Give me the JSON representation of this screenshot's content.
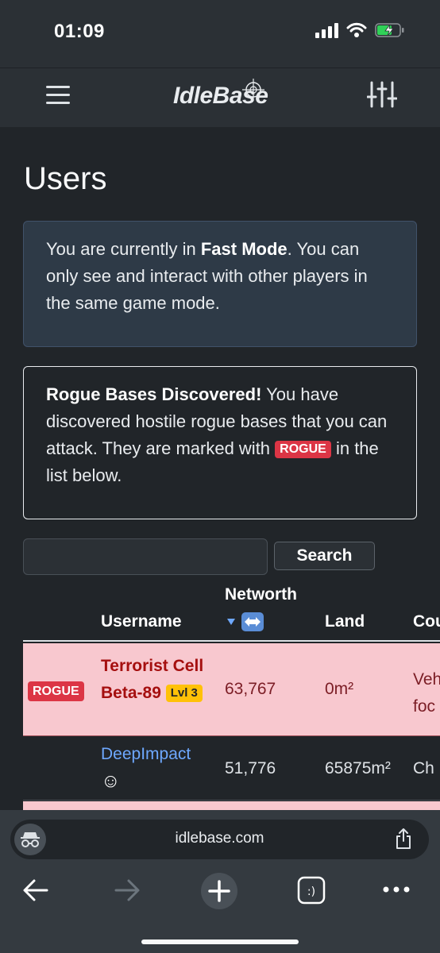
{
  "status": {
    "time": "01:09"
  },
  "navbar": {
    "logo": "IdleBase"
  },
  "page": {
    "title": "Users",
    "info_alert": {
      "prefix": "You are currently in ",
      "bold": "Fast Mode",
      "suffix": ". You can only see and interact with other players in the same game mode."
    },
    "rogue_alert": {
      "bold": "Rogue Bases Discovered!",
      "text": " You have discovered hostile rogue bases that you can attack. They are marked with ",
      "badge": "ROGUE",
      "suffix": " in the list below."
    }
  },
  "search": {
    "value": "",
    "button_label": "Search"
  },
  "table": {
    "headers": {
      "username": "Username",
      "networth": "Networth",
      "land": "Land",
      "country": "Cou"
    },
    "rows": [
      {
        "badge": "ROGUE",
        "username": "Terrorist Cell Beta-89",
        "level": "Lvl 3",
        "networth": "63,767",
        "land": "0m²",
        "country": "Veh foc"
      },
      {
        "username": "DeepImpact",
        "emoji": "☺",
        "networth": "51,776",
        "land": "65875m²",
        "country": "Ch"
      }
    ]
  },
  "browser": {
    "url": "idlebase.com"
  },
  "colors": {
    "rogue_row": "#f8c8cf",
    "rogue_badge": "#dc3545",
    "level_badge": "#ffc107",
    "link": "#6ea8fe"
  }
}
